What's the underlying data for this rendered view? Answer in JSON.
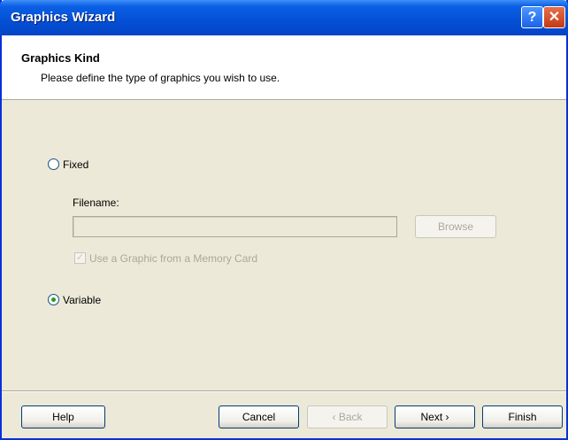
{
  "window": {
    "title": "Graphics Wizard",
    "help_glyph": "?",
    "close_glyph": "✕"
  },
  "header": {
    "title": "Graphics Kind",
    "subtitle": "Please define the type of graphics you wish to use."
  },
  "options": {
    "fixed_label": "Fixed",
    "fixed_selected": false,
    "filename_label": "Filename:",
    "filename_value": "",
    "browse_label": "Browse",
    "memory_card_label": "Use a Graphic from a Memory Card",
    "memory_card_checked": true,
    "variable_label": "Variable",
    "variable_selected": true
  },
  "footer": {
    "help_label": "Help",
    "cancel_label": "Cancel",
    "back_label": "‹ Back",
    "next_label": "Next ›",
    "finish_label": "Finish"
  },
  "colors": {
    "accent": "#0451d6",
    "radio_dot": "#21a121"
  }
}
